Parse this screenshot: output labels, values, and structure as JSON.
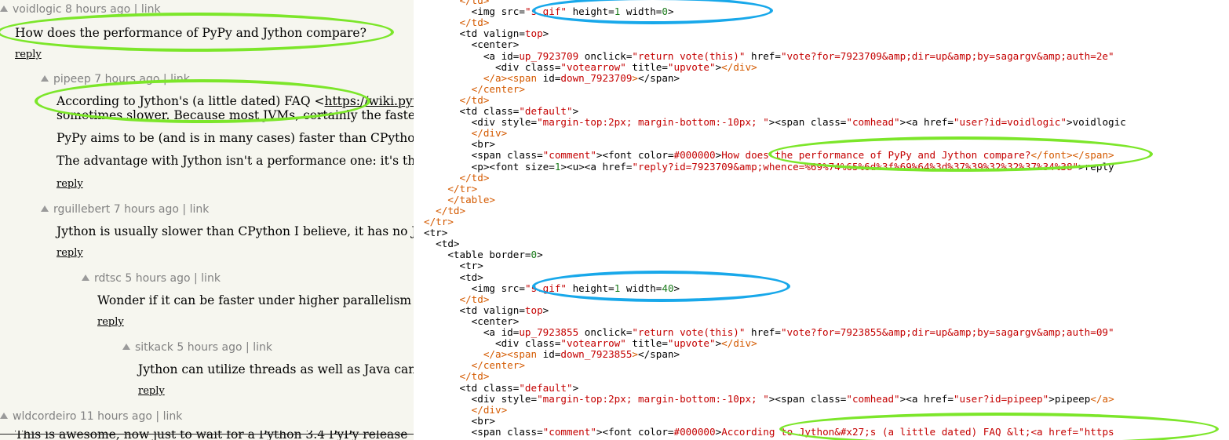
{
  "comments": [
    {
      "user": "voidlogic",
      "age": "8 hours ago",
      "sep": " | ",
      "link": "link",
      "lines": [
        "How does the performance of PyPy and Jython compare?"
      ],
      "reply": "reply"
    },
    {
      "user": "pipeep",
      "age": "7 hours ago",
      "sep": " | ",
      "link": "link",
      "lines": [
        "According to Jython's (a little dated) FAQ <https://wiki.python.org",
        "sometimes slower. Because most JVMs, certainly the fastest",
        "PyPy aims to be (and is in many cases) faster than CPython",
        "The advantage with Jython isn't a performance one: it's the"
      ],
      "link_text": "https://wiki.pyt",
      "reply": "reply"
    },
    {
      "user": "rguillebert",
      "age": "7 hours ago",
      "sep": " | ",
      "link": "link",
      "lines": [
        "Jython is usually slower than CPython I believe, it has no JIT"
      ],
      "reply": "reply"
    },
    {
      "user": "rdtsc",
      "age": "5 hours ago",
      "sep": " | ",
      "link": "link",
      "lines": [
        "Wonder if it can be faster under higher parallelism"
      ],
      "reply": "reply"
    },
    {
      "user": "sitkack",
      "age": "5 hours ago",
      "sep": " | ",
      "link": "link",
      "lines": [
        "Jython can utilize threads as well as Java can"
      ],
      "reply": "reply"
    },
    {
      "user": "wldcordeiro",
      "age": "11 hours ago",
      "sep": " | ",
      "link": "link",
      "lines": []
    }
  ],
  "footer_text": "This is awesome, now just to wait for a Python 3.4 PyPy release",
  "source_lines": [
    [
      "      ",
      [
        "o",
        "</td>"
      ]
    ],
    [
      "        ",
      [
        "tg",
        "<img "
      ],
      [
        "at",
        "src="
      ],
      [
        "v",
        "\"s.gif\""
      ],
      [
        "at",
        " height="
      ],
      [
        "n",
        "1"
      ],
      [
        "at",
        " width="
      ],
      [
        "n",
        "0"
      ],
      [
        "tg",
        ">"
      ]
    ],
    [
      "      ",
      [
        "o",
        "</td>"
      ]
    ],
    [
      "      ",
      [
        "tg",
        "<td "
      ],
      [
        "at",
        "valign="
      ],
      [
        "v",
        "top"
      ],
      [
        "tg",
        ">"
      ]
    ],
    [
      "        ",
      [
        "tg",
        "<center>"
      ]
    ],
    [
      "          ",
      [
        "tg",
        "<a "
      ],
      [
        "at",
        "id="
      ],
      [
        "v",
        "up_7923709"
      ],
      [
        "at",
        " onclick="
      ],
      [
        "v",
        "\"return vote(this)\""
      ],
      [
        "at",
        " href="
      ],
      [
        "v",
        "\"vote?for=7923709&amp;dir=up&amp;by=sagargv&amp;auth=2e\""
      ]
    ],
    [
      "            ",
      [
        "tg",
        "<div "
      ],
      [
        "at",
        "class="
      ],
      [
        "v",
        "\"votearrow\""
      ],
      [
        "at",
        " title="
      ],
      [
        "v",
        "\"upvote\""
      ],
      [
        "tg",
        ">"
      ],
      [
        "o",
        "</div>"
      ]
    ],
    [
      "          ",
      [
        "o",
        "</a>"
      ],
      [
        "o",
        "<span "
      ],
      [
        "at",
        "id="
      ],
      [
        "v",
        "down_7923709"
      ],
      [
        "o",
        ">"
      ],
      [
        "tg",
        "</span>"
      ]
    ],
    [
      "        ",
      [
        "o",
        "</center>"
      ]
    ],
    [
      "      ",
      [
        "o",
        "</td>"
      ]
    ],
    [
      "      ",
      [
        "tg",
        "<td "
      ],
      [
        "at",
        "class="
      ],
      [
        "v",
        "\"default\""
      ],
      [
        "tg",
        ">"
      ]
    ],
    [
      "        ",
      [
        "tg",
        "<div "
      ],
      [
        "at",
        "style="
      ],
      [
        "v",
        "\"margin-top:2px; margin-bottom:-10px; \""
      ],
      [
        "tg",
        ">"
      ],
      [
        "tg",
        "<span "
      ],
      [
        "at",
        "class="
      ],
      [
        "v",
        "\"comhead\""
      ],
      [
        "tg",
        ">"
      ],
      [
        "tg",
        "<a "
      ],
      [
        "at",
        "href="
      ],
      [
        "v",
        "\"user?id=voidlogic\""
      ],
      [
        "tg",
        ">"
      ],
      [
        "tg",
        "voidlogic"
      ]
    ],
    [
      "        ",
      [
        "o",
        "</div>"
      ]
    ],
    [
      "        ",
      [
        "tg",
        "<br>"
      ]
    ],
    [
      "        ",
      [
        "tg",
        "<span "
      ],
      [
        "at",
        "class="
      ],
      [
        "v",
        "\"comment\""
      ],
      [
        "tg",
        ">"
      ],
      [
        "tg",
        "<font "
      ],
      [
        "at",
        "color="
      ],
      [
        "v",
        "#000000"
      ],
      [
        "tg",
        ">"
      ],
      [
        "v",
        "How does the performance of PyPy and Jython compare?"
      ],
      [
        "o",
        "</font>"
      ],
      [
        "o",
        "</span>"
      ]
    ],
    [
      "        ",
      [
        "tg",
        "<p>"
      ],
      [
        "tg",
        "<font "
      ],
      [
        "at",
        "size="
      ],
      [
        "n",
        "1"
      ],
      [
        "tg",
        ">"
      ],
      [
        "tg",
        "<u>"
      ],
      [
        "tg",
        "<a "
      ],
      [
        "at",
        "href="
      ],
      [
        "v",
        "\"reply?id=7923709&amp;whence=%69%74%65%6d%3f%69%64%3d%37%39%32%32%37%34%38\""
      ],
      [
        "tg",
        ">"
      ],
      [
        "tg",
        "reply"
      ]
    ],
    [
      "      ",
      [
        "o",
        "</td>"
      ]
    ],
    [
      "    ",
      [
        "o",
        "</tr>"
      ]
    ],
    [
      "    ",
      [
        "o",
        "</table>"
      ]
    ],
    [
      "  ",
      [
        "o",
        "</td>"
      ]
    ],
    [
      "",
      [
        "o",
        "</tr>"
      ]
    ],
    [
      "",
      [
        "tg",
        "<tr>"
      ]
    ],
    [
      "  ",
      [
        "tg",
        "<td>"
      ]
    ],
    [
      "    ",
      [
        "tg",
        "<table "
      ],
      [
        "at",
        "border="
      ],
      [
        "n",
        "0"
      ],
      [
        "tg",
        ">"
      ]
    ],
    [
      "      ",
      [
        "tg",
        "<tr>"
      ]
    ],
    [
      "      ",
      [
        "tg",
        "<td>"
      ]
    ],
    [
      "        ",
      [
        "tg",
        "<img "
      ],
      [
        "at",
        "src="
      ],
      [
        "v",
        "\"s.gif\""
      ],
      [
        "at",
        " height="
      ],
      [
        "n",
        "1"
      ],
      [
        "at",
        " width="
      ],
      [
        "n",
        "40"
      ],
      [
        "tg",
        ">"
      ]
    ],
    [
      "      ",
      [
        "o",
        "</td>"
      ]
    ],
    [
      "      ",
      [
        "tg",
        "<td "
      ],
      [
        "at",
        "valign="
      ],
      [
        "v",
        "top"
      ],
      [
        "tg",
        ">"
      ]
    ],
    [
      "        ",
      [
        "tg",
        "<center>"
      ]
    ],
    [
      "          ",
      [
        "tg",
        "<a "
      ],
      [
        "at",
        "id="
      ],
      [
        "v",
        "up_7923855"
      ],
      [
        "at",
        " onclick="
      ],
      [
        "v",
        "\"return vote(this)\""
      ],
      [
        "at",
        " href="
      ],
      [
        "v",
        "\"vote?for=7923855&amp;dir=up&amp;by=sagargv&amp;auth=09\""
      ]
    ],
    [
      "            ",
      [
        "tg",
        "<div "
      ],
      [
        "at",
        "class="
      ],
      [
        "v",
        "\"votearrow\""
      ],
      [
        "at",
        " title="
      ],
      [
        "v",
        "\"upvote\""
      ],
      [
        "tg",
        ">"
      ],
      [
        "o",
        "</div>"
      ]
    ],
    [
      "          ",
      [
        "o",
        "</a>"
      ],
      [
        "o",
        "<span "
      ],
      [
        "at",
        "id="
      ],
      [
        "v",
        "down_7923855"
      ],
      [
        "o",
        ">"
      ],
      [
        "tg",
        "</span>"
      ]
    ],
    [
      "        ",
      [
        "o",
        "</center>"
      ]
    ],
    [
      "      ",
      [
        "o",
        "</td>"
      ]
    ],
    [
      "      ",
      [
        "tg",
        "<td "
      ],
      [
        "at",
        "class="
      ],
      [
        "v",
        "\"default\""
      ],
      [
        "tg",
        ">"
      ]
    ],
    [
      "        ",
      [
        "tg",
        "<div "
      ],
      [
        "at",
        "style="
      ],
      [
        "v",
        "\"margin-top:2px; margin-bottom:-10px; \""
      ],
      [
        "tg",
        ">"
      ],
      [
        "tg",
        "<span "
      ],
      [
        "at",
        "class="
      ],
      [
        "v",
        "\"comhead\""
      ],
      [
        "tg",
        ">"
      ],
      [
        "tg",
        "<a "
      ],
      [
        "at",
        "href="
      ],
      [
        "v",
        "\"user?id=pipeep\""
      ],
      [
        "tg",
        ">"
      ],
      [
        "tg",
        "pipeep"
      ],
      [
        "o",
        "</a>"
      ]
    ],
    [
      "        ",
      [
        "o",
        "</div>"
      ]
    ],
    [
      "        ",
      [
        "tg",
        "<br>"
      ]
    ],
    [
      "        ",
      [
        "tg",
        "<span "
      ],
      [
        "at",
        "class="
      ],
      [
        "v",
        "\"comment\""
      ],
      [
        "tg",
        ">"
      ],
      [
        "tg",
        "<font "
      ],
      [
        "at",
        "color="
      ],
      [
        "v",
        "#000000"
      ],
      [
        "tg",
        ">"
      ],
      [
        "v",
        "According to Jython&#x27;s (a little dated) FAQ &lt;<a href=\"https"
      ]
    ]
  ]
}
